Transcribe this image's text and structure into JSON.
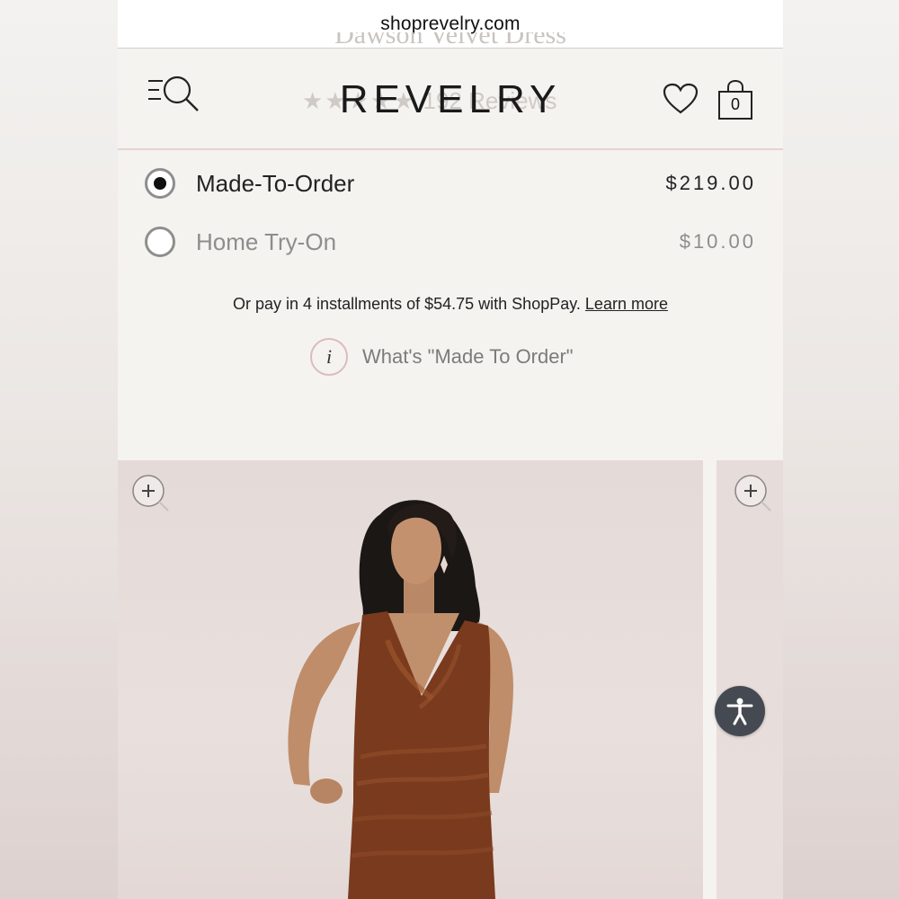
{
  "browser": {
    "url": "shoprevelry.com"
  },
  "header": {
    "brand": "REVELRY",
    "bag_count": "0",
    "behind_title": "Dawson Velvet Dress",
    "behind_reviews": "192 Reviews"
  },
  "purchase_options": [
    {
      "label": "Made-To-Order",
      "price": "$219.00",
      "selected": true
    },
    {
      "label": "Home Try-On",
      "price": "$10.00",
      "selected": false
    }
  ],
  "shoppay": {
    "text": "Or pay in 4 installments of $54.75 with ShopPay.",
    "link": "Learn more"
  },
  "made_to_order_info": {
    "icon": "i",
    "label": "What's \"Made To Order\""
  },
  "icons": {
    "menu_search": "menu-search-icon",
    "wishlist": "heart-icon",
    "bag": "shopping-bag-icon",
    "zoom": "zoom-in-icon",
    "accessibility": "accessibility-icon"
  },
  "colors": {
    "page_bg": "#f5f3f0",
    "divider": "#e7d2d2",
    "dress": "#7a3a1e",
    "accessibility_bg": "#454a52"
  }
}
